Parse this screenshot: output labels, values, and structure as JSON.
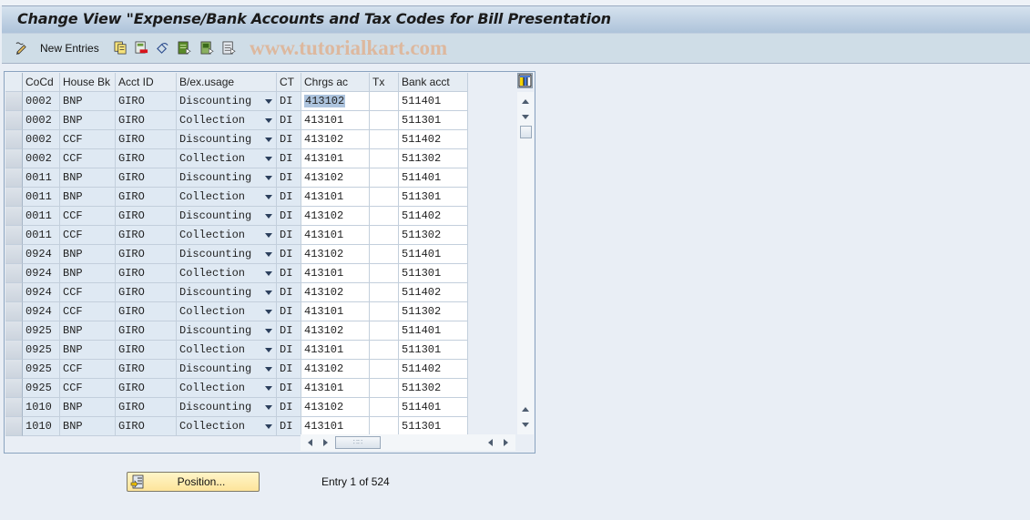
{
  "window": {
    "title": "Change View \"Expense/Bank Accounts and Tax Codes for Bill Presentation"
  },
  "toolbar": {
    "new_entries_label": "New Entries",
    "watermark": "www.tutorialkart.com",
    "icons": [
      "edit-pencil-icon",
      "copy-icon",
      "delete-icon",
      "undo-icon",
      "select-all-icon",
      "select-block-icon",
      "deselect-all-icon"
    ]
  },
  "table": {
    "columns": [
      "CoCd",
      "House Bk",
      "Acct ID",
      "B/ex.usage",
      "CT",
      "Chrgs ac",
      "Tx",
      "Bank acct"
    ],
    "rows": [
      [
        "0002",
        "BNP",
        "GIRO",
        "Discounting",
        "DI",
        "413102",
        "",
        "511401"
      ],
      [
        "0002",
        "BNP",
        "GIRO",
        "Collection",
        "DI",
        "413101",
        "",
        "511301"
      ],
      [
        "0002",
        "CCF",
        "GIRO",
        "Discounting",
        "DI",
        "413102",
        "",
        "511402"
      ],
      [
        "0002",
        "CCF",
        "GIRO",
        "Collection",
        "DI",
        "413101",
        "",
        "511302"
      ],
      [
        "0011",
        "BNP",
        "GIRO",
        "Discounting",
        "DI",
        "413102",
        "",
        "511401"
      ],
      [
        "0011",
        "BNP",
        "GIRO",
        "Collection",
        "DI",
        "413101",
        "",
        "511301"
      ],
      [
        "0011",
        "CCF",
        "GIRO",
        "Discounting",
        "DI",
        "413102",
        "",
        "511402"
      ],
      [
        "0011",
        "CCF",
        "GIRO",
        "Collection",
        "DI",
        "413101",
        "",
        "511302"
      ],
      [
        "0924",
        "BNP",
        "GIRO",
        "Discounting",
        "DI",
        "413102",
        "",
        "511401"
      ],
      [
        "0924",
        "BNP",
        "GIRO",
        "Collection",
        "DI",
        "413101",
        "",
        "511301"
      ],
      [
        "0924",
        "CCF",
        "GIRO",
        "Discounting",
        "DI",
        "413102",
        "",
        "511402"
      ],
      [
        "0924",
        "CCF",
        "GIRO",
        "Collection",
        "DI",
        "413101",
        "",
        "511302"
      ],
      [
        "0925",
        "BNP",
        "GIRO",
        "Discounting",
        "DI",
        "413102",
        "",
        "511401"
      ],
      [
        "0925",
        "BNP",
        "GIRO",
        "Collection",
        "DI",
        "413101",
        "",
        "511301"
      ],
      [
        "0925",
        "CCF",
        "GIRO",
        "Discounting",
        "DI",
        "413102",
        "",
        "511402"
      ],
      [
        "0925",
        "CCF",
        "GIRO",
        "Collection",
        "DI",
        "413101",
        "",
        "511302"
      ],
      [
        "1010",
        "BNP",
        "GIRO",
        "Discounting",
        "DI",
        "413102",
        "",
        "511401"
      ],
      [
        "1010",
        "BNP",
        "GIRO",
        "Collection",
        "DI",
        "413101",
        "",
        "511301"
      ]
    ]
  },
  "footer": {
    "position_button_label": "Position...",
    "entry_info": "Entry 1 of 524"
  }
}
